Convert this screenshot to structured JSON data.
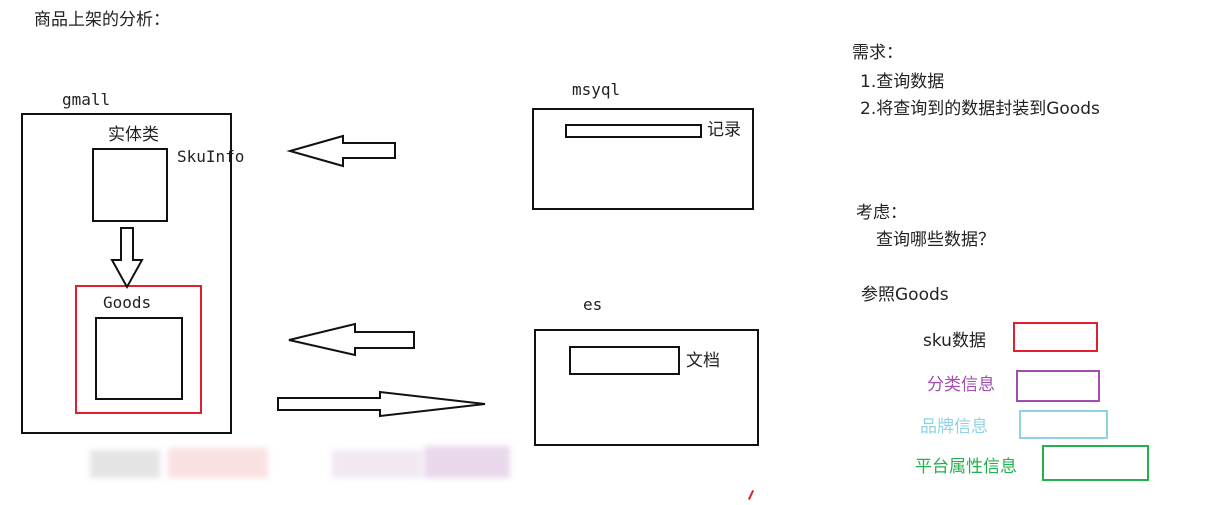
{
  "title": "商品上架的分析：",
  "gmall": {
    "label": "gmall",
    "entity_label": "实体类",
    "skuinfo_label": "SkuInfo",
    "goods_label": "Goods"
  },
  "mysql": {
    "label": "msyql",
    "record_label": "记录"
  },
  "es": {
    "label": "es",
    "doc_label": "文档"
  },
  "requirements": {
    "heading": "需求：",
    "items": [
      "1.查询数据",
      "2.将查询到的数据封装到Goods"
    ]
  },
  "consider": {
    "heading": "考虑：",
    "question": "查询哪些数据？"
  },
  "reference": "参照Goods",
  "legend": [
    {
      "label": "sku数据",
      "color": "#e0202a",
      "text_color": "#222222"
    },
    {
      "label": "分类信息",
      "color": "#a34db0",
      "text_color": "#a34db0"
    },
    {
      "label": "品牌信息",
      "color": "#8fd3e3",
      "text_color": "#8fd3e3"
    },
    {
      "label": "平台属性信息",
      "color": "#22b14c",
      "text_color": "#22b14c"
    }
  ]
}
